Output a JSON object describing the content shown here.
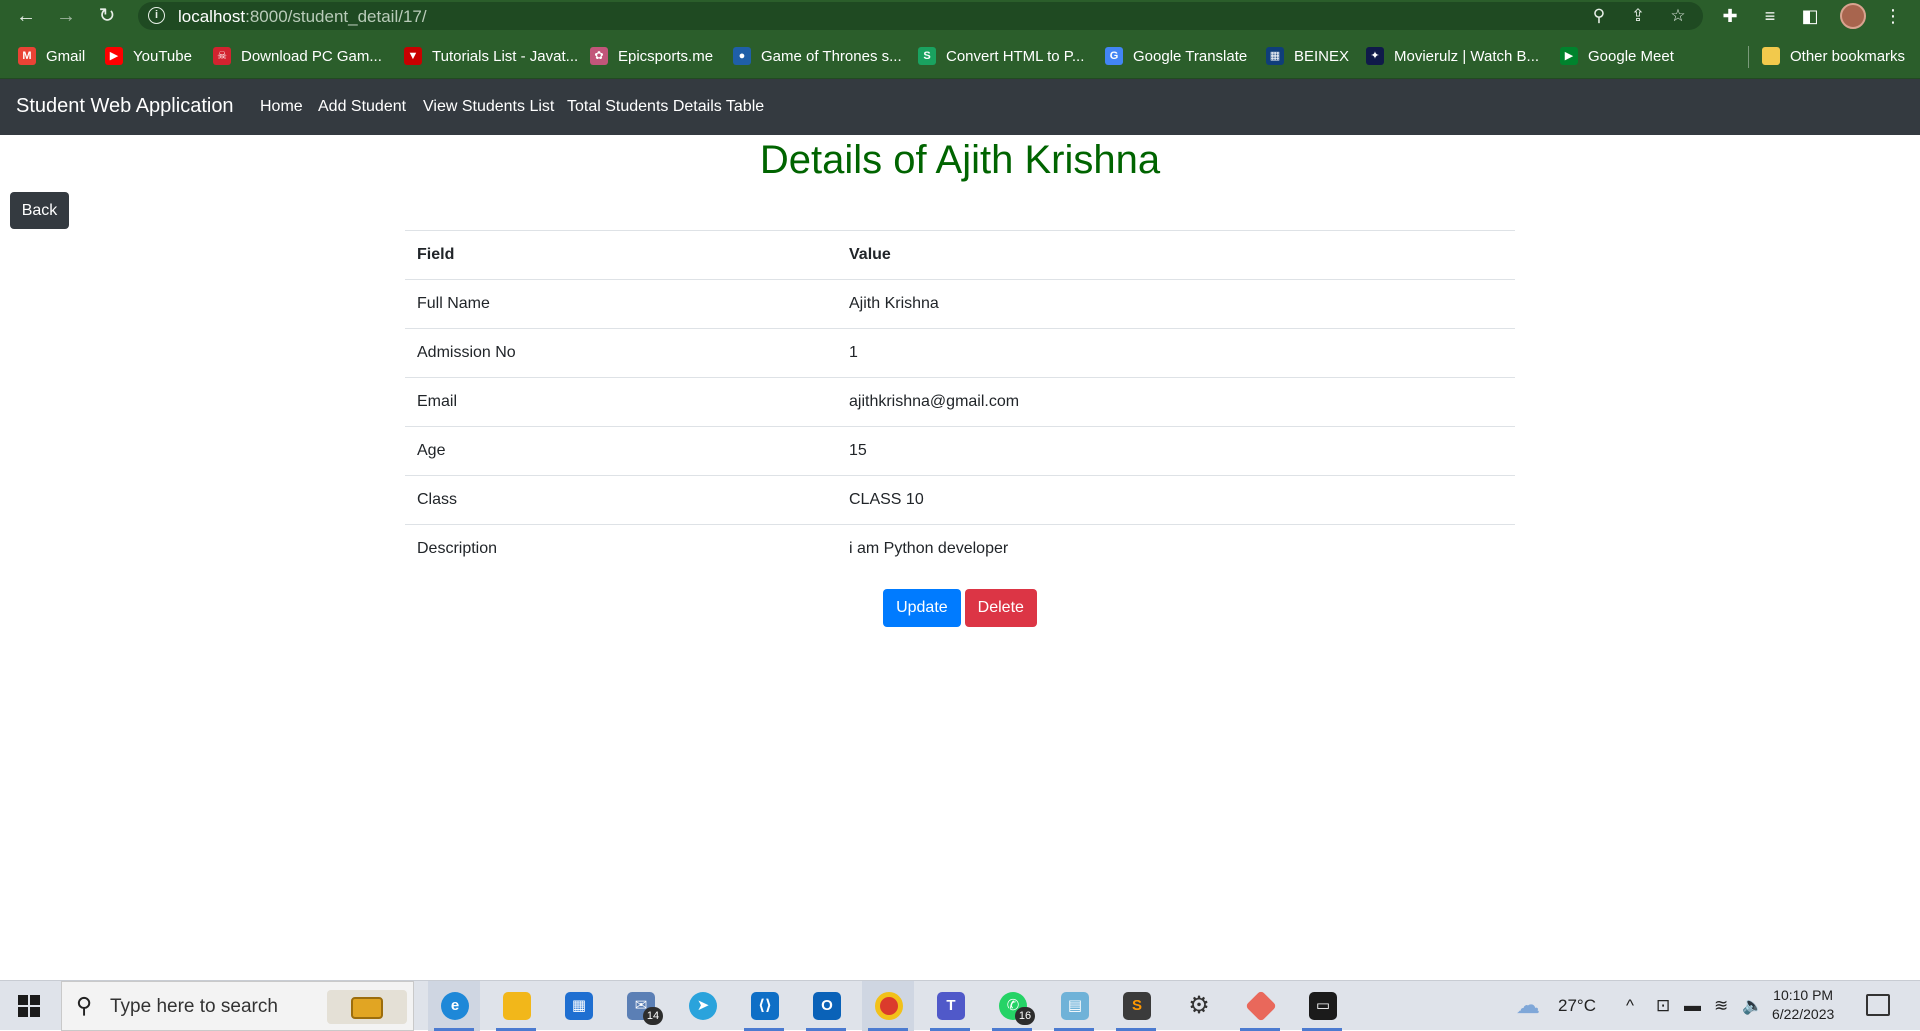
{
  "browser": {
    "url_host": "localhost",
    "url_path": ":8000/student_detail/17/",
    "bookmarks": [
      {
        "label": "Gmail",
        "icon": "gmail-icon",
        "color": "#ea4335",
        "glyph": "M"
      },
      {
        "label": "YouTube",
        "icon": "youtube-icon",
        "color": "#ff0000",
        "glyph": "▶"
      },
      {
        "label": "Download PC Gam...",
        "icon": "game-icon",
        "color": "#d3232f",
        "glyph": "☠"
      },
      {
        "label": "Tutorials List - Javat...",
        "icon": "javatpoint-icon",
        "color": "#c90000",
        "glyph": "▼"
      },
      {
        "label": "Epicsports.me",
        "icon": "epicsports-icon",
        "color": "#c2567a",
        "glyph": "✿"
      },
      {
        "label": "Game of Thrones s...",
        "icon": "globe-icon",
        "color": "#1f5fa8",
        "glyph": "●"
      },
      {
        "label": "Convert HTML to P...",
        "icon": "convert-icon",
        "color": "#1aa260",
        "glyph": "S"
      },
      {
        "label": "Google Translate",
        "icon": "translate-icon",
        "color": "#4285f4",
        "glyph": "G"
      },
      {
        "label": "BEINEX",
        "icon": "beinex-icon",
        "color": "#0f3e7a",
        "glyph": "▦"
      },
      {
        "label": "Movierulz | Watch B...",
        "icon": "movierulz-icon",
        "color": "#101a4a",
        "glyph": "✦"
      },
      {
        "label": "Google Meet",
        "icon": "meet-icon",
        "color": "#00832d",
        "glyph": "▶"
      }
    ],
    "other_bookmarks": "Other bookmarks"
  },
  "navbar": {
    "brand": "Student Web Application",
    "links": [
      "Home",
      "Add Student",
      "View Students List",
      "Total Students Details Table"
    ]
  },
  "page": {
    "title": "Details of Ajith Krishna",
    "back_label": "Back",
    "table": {
      "headers": [
        "Field",
        "Value"
      ],
      "rows": [
        [
          "Full Name",
          "Ajith Krishna"
        ],
        [
          "Admission No",
          "1"
        ],
        [
          "Email",
          "ajithkrishna@gmail.com"
        ],
        [
          "Age",
          "15"
        ],
        [
          "Class",
          "CLASS 10"
        ],
        [
          "Description",
          "i am Python developer"
        ]
      ]
    },
    "update_label": "Update",
    "delete_label": "Delete"
  },
  "colors": {
    "title_green": "#006400",
    "navbar_dark": "#343a40",
    "primary": "#007bff",
    "danger": "#dc3545",
    "chrome_green": "#2b5e2b"
  },
  "taskbar": {
    "search_placeholder": "Type here to search",
    "mail_badge": "14",
    "whatsapp_badge": "16",
    "temperature": "27°C",
    "time": "10:10 PM",
    "date": "6/22/2023"
  }
}
